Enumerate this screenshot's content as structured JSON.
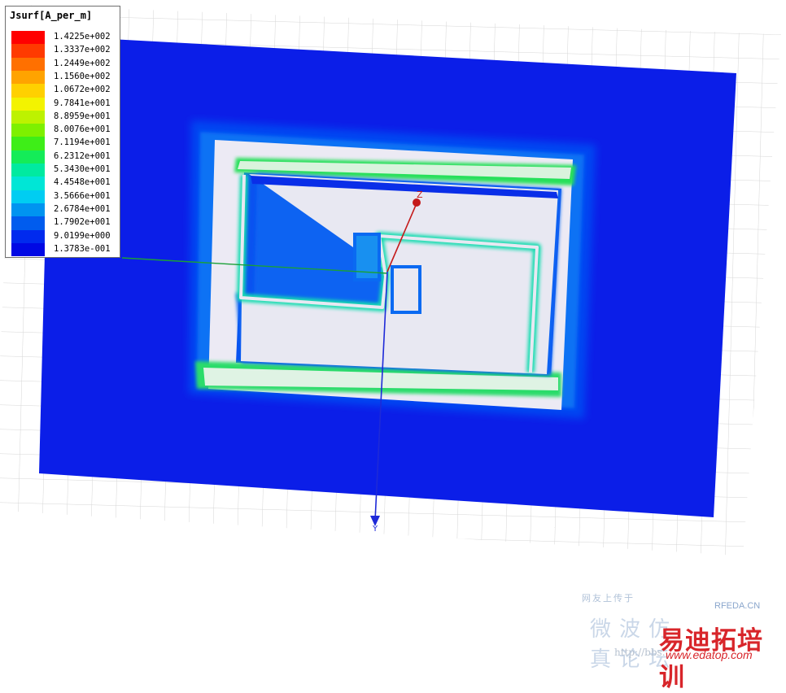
{
  "legend": {
    "title": "Jsurf[A_per_m]",
    "entries": [
      {
        "label": "1.4225e+002",
        "color": "#ff0000"
      },
      {
        "label": "1.3337e+002",
        "color": "#ff3a00"
      },
      {
        "label": "1.2449e+002",
        "color": "#ff7000"
      },
      {
        "label": "1.1560e+002",
        "color": "#ffa300"
      },
      {
        "label": "1.0672e+002",
        "color": "#ffd000"
      },
      {
        "label": "9.7841e+001",
        "color": "#f3f300"
      },
      {
        "label": "8.8959e+001",
        "color": "#bdf200"
      },
      {
        "label": "8.0076e+001",
        "color": "#7ef000"
      },
      {
        "label": "7.1194e+001",
        "color": "#3eee18"
      },
      {
        "label": "6.2312e+001",
        "color": "#14ec58"
      },
      {
        "label": "5.3430e+001",
        "color": "#00eaa0"
      },
      {
        "label": "4.4548e+001",
        "color": "#00e6d6"
      },
      {
        "label": "3.5666e+001",
        "color": "#00cdf2"
      },
      {
        "label": "2.6784e+001",
        "color": "#0094f0"
      },
      {
        "label": "1.7902e+001",
        "color": "#005cee"
      },
      {
        "label": "9.0199e+000",
        "color": "#002aee"
      },
      {
        "label": "1.3783e-001",
        "color": "#0008e4"
      }
    ]
  },
  "axes": {
    "z_label": "Z",
    "y_label": "Y"
  },
  "watermark": {
    "top_text": "网友上传于",
    "big_text": "微波仿真论坛",
    "url_text": "http://bbs.",
    "rfeda_text": "RFEDA.CN",
    "brand_text": "易迪拓培训",
    "brand_url": "www.edatop.com"
  }
}
